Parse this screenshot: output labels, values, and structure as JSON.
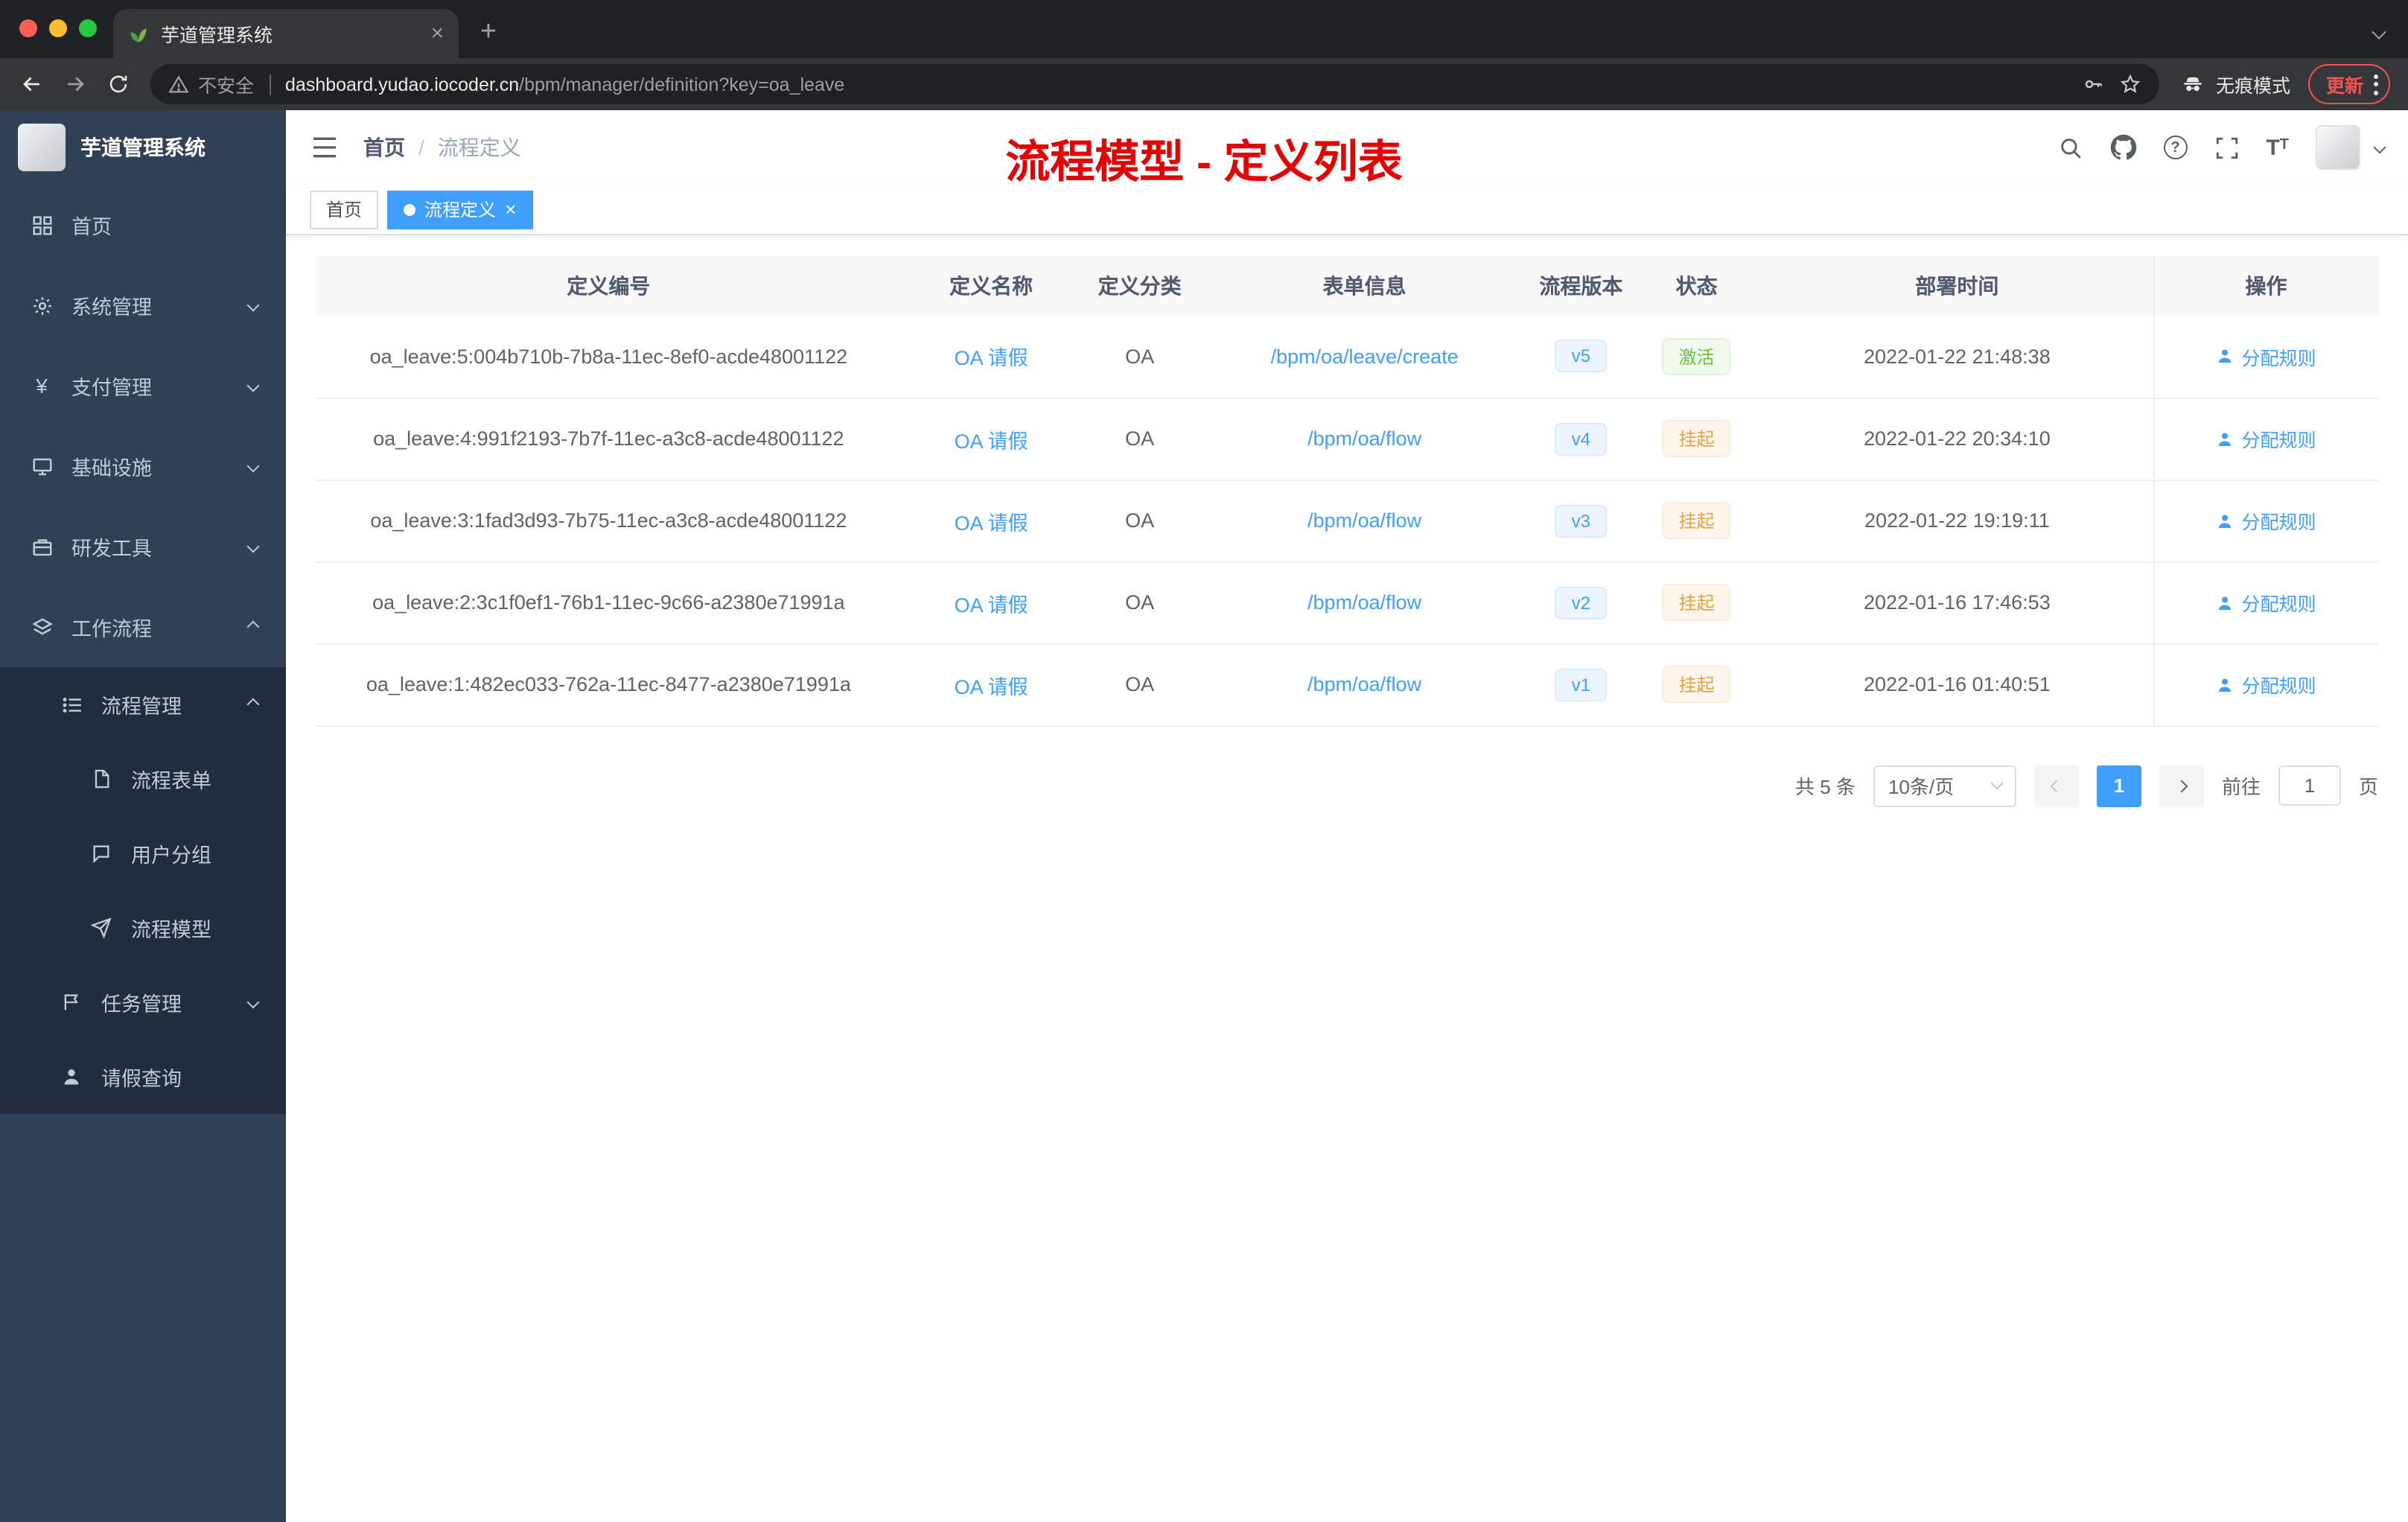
{
  "browser": {
    "tab_title": "芋道管理系统",
    "security_label": "不安全",
    "url_host": "dashboard.yudao.iocoder.cn",
    "url_path": "/bpm/manager/definition?key=oa_leave",
    "incognito_label": "无痕模式",
    "update_label": "更新"
  },
  "sidebar": {
    "logo_title": "芋道管理系统",
    "items": [
      {
        "label": "首页"
      },
      {
        "label": "系统管理"
      },
      {
        "label": "支付管理"
      },
      {
        "label": "基础设施"
      },
      {
        "label": "研发工具"
      },
      {
        "label": "工作流程"
      },
      {
        "label": "流程管理"
      },
      {
        "label": "流程表单"
      },
      {
        "label": "用户分组"
      },
      {
        "label": "流程模型"
      },
      {
        "label": "任务管理"
      },
      {
        "label": "请假查询"
      }
    ]
  },
  "header": {
    "breadcrumb_home": "首页",
    "breadcrumb_separator": "/",
    "breadcrumb_current": "流程定义",
    "annotation": "流程模型 - 定义列表"
  },
  "tags": {
    "home": "首页",
    "active": "流程定义"
  },
  "table": {
    "columns": [
      "定义编号",
      "定义名称",
      "定义分类",
      "表单信息",
      "流程版本",
      "状态",
      "部署时间",
      "操作"
    ],
    "rows": [
      {
        "id": "oa_leave:5:004b710b-7b8a-11ec-8ef0-acde48001122",
        "name": "OA 请假",
        "category": "OA",
        "form": "/bpm/oa/leave/create",
        "version": "v5",
        "status": "激活",
        "time": "2022-01-22 21:48:38",
        "action": "分配规则"
      },
      {
        "id": "oa_leave:4:991f2193-7b7f-11ec-a3c8-acde48001122",
        "name": "OA 请假",
        "category": "OA",
        "form": "/bpm/oa/flow",
        "version": "v4",
        "status": "挂起",
        "time": "2022-01-22 20:34:10",
        "action": "分配规则"
      },
      {
        "id": "oa_leave:3:1fad3d93-7b75-11ec-a3c8-acde48001122",
        "name": "OA 请假",
        "category": "OA",
        "form": "/bpm/oa/flow",
        "version": "v3",
        "status": "挂起",
        "time": "2022-01-22 19:19:11",
        "action": "分配规则"
      },
      {
        "id": "oa_leave:2:3c1f0ef1-76b1-11ec-9c66-a2380e71991a",
        "name": "OA 请假",
        "category": "OA",
        "form": "/bpm/oa/flow",
        "version": "v2",
        "status": "挂起",
        "time": "2022-01-16 17:46:53",
        "action": "分配规则"
      },
      {
        "id": "oa_leave:1:482ec033-762a-11ec-8477-a2380e71991a",
        "name": "OA 请假",
        "category": "OA",
        "form": "/bpm/oa/flow",
        "version": "v1",
        "status": "挂起",
        "time": "2022-01-16 01:40:51",
        "action": "分配规则"
      }
    ]
  },
  "pagination": {
    "total": "共 5 条",
    "page_size": "10条/页",
    "current_page": "1",
    "goto_label": "前往",
    "goto_value": "1",
    "goto_unit": "页"
  },
  "icons": {
    "tab_close": "×",
    "new_tab": "+",
    "tag_close": "×",
    "question_mark": "?",
    "yen": "¥",
    "text_size": "T"
  },
  "colors": {
    "accent": "#409eff",
    "success": "#67c23a",
    "warning": "#e6a23c",
    "annotation": "#e60000",
    "sidebar_bg": "#304156",
    "submenu_bg": "#1f2d3d"
  }
}
